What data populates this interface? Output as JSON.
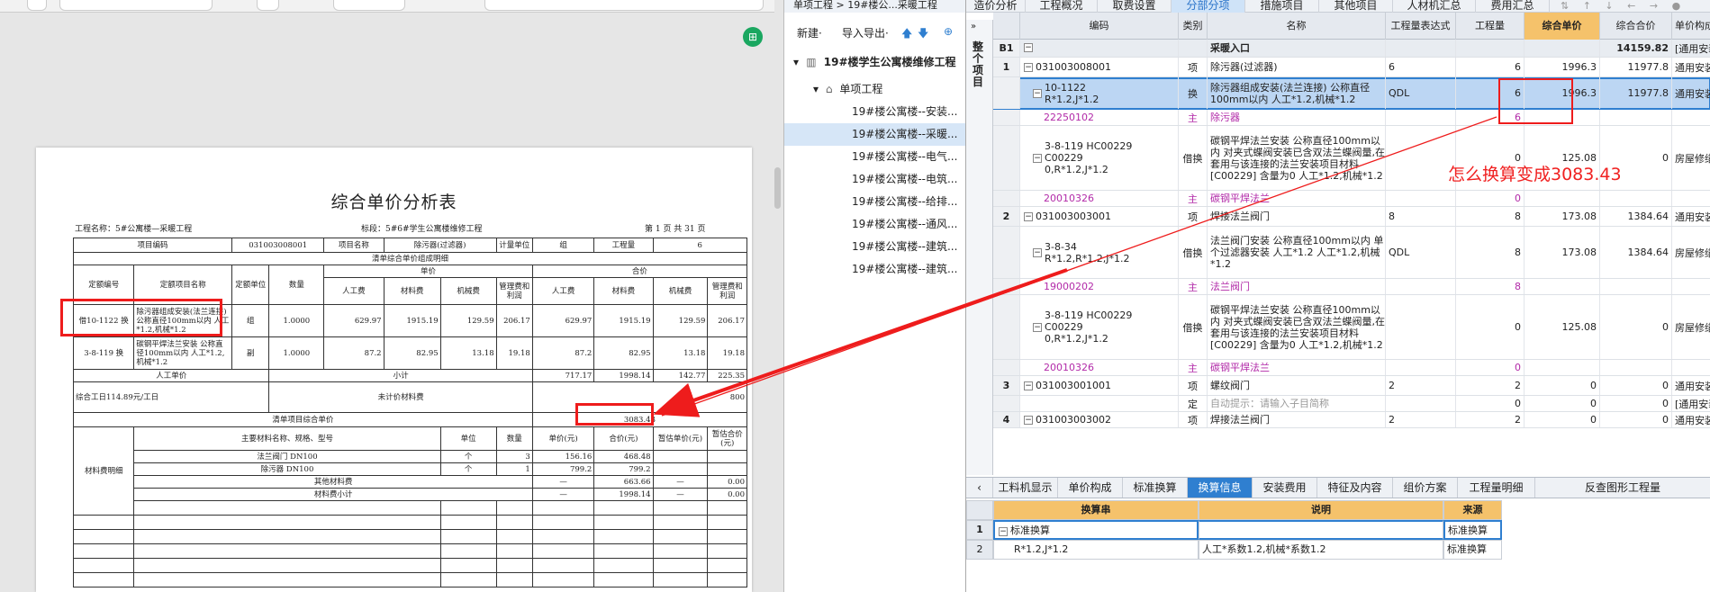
{
  "doc": {
    "title": "综合单价分析表",
    "project": "工程名称：5#公寓楼—采暖工程",
    "section": "标段：5#6#学生公寓楼维修工程",
    "page": "第 1 页    共 31 页",
    "info": [
      "项目编码",
      "031003008001",
      "项目名称",
      "除污器(过滤器)",
      "计量单位",
      "组",
      "工程量",
      "6"
    ],
    "group_title": "清单综合单价组成明细",
    "h_quota_no": "定额编号",
    "h_quota_name": "定额项目名称",
    "h_unit": "定额单位",
    "h_qty": "数量",
    "h_unit_price": "单价",
    "h_total": "合价",
    "h_cols": [
      "人工费",
      "材料费",
      "机械费",
      "管理费和利润",
      "人工费",
      "材料费",
      "机械费",
      "管理费和利润"
    ],
    "rows": [
      {
        "no": "借10-1122 换",
        "name": "除污器组成安装(法兰连接) 公称直径100mm以内 人工*1.2,机械*1.2",
        "unit": "组",
        "qty": "1.0000",
        "vals": [
          "629.97",
          "1915.19",
          "129.59",
          "206.17",
          "629.97",
          "1915.19",
          "129.59",
          "206.17"
        ]
      },
      {
        "no": "3-8-119 换",
        "name": "碳钢平焊法兰安装 公称直径100mm以内 人工*1.2,机械*1.2",
        "unit": "副",
        "qty": "1.0000",
        "vals": [
          "87.2",
          "82.95",
          "13.18",
          "19.18",
          "87.2",
          "82.95",
          "13.18",
          "19.18"
        ]
      }
    ],
    "labor_unit_price": "人工单价",
    "subtotal": "小计",
    "subtotal_vals": [
      "717.17",
      "1998.14",
      "142.77",
      "225.35"
    ],
    "workday": "综合工日114.89元/工日",
    "unpriced": "未计价材料费",
    "unpriced_val": "800",
    "unit_price_label": "清单项目综合单价",
    "unit_price_val": "3083.43",
    "mat_label": "材料费明细",
    "mat_headers": [
      "主要材料名称、规格、型号",
      "单位",
      "数量",
      "单价(元)",
      "合价(元)",
      "暂估单价(元)",
      "暂估合价(元)"
    ],
    "materials": [
      {
        "name": "法兰阀门 DN100",
        "unit": "个",
        "qty": "3",
        "price": "156.16",
        "total": "468.48",
        "est": "",
        "esttotal": ""
      },
      {
        "name": "除污器 DN100",
        "unit": "个",
        "qty": "1",
        "price": "799.2",
        "total": "799.2",
        "est": "",
        "esttotal": ""
      }
    ],
    "other_mat": "其他材料费",
    "other_vals": [
      "—",
      "663.66",
      "—",
      "0.00"
    ],
    "mat_subtotal": "材料费小计",
    "mat_sub_vals": [
      "—",
      "1998.14",
      "—",
      "0.00"
    ]
  },
  "tree": {
    "breadcrumb": "单项工程 > 19#楼公...采暖工程",
    "new": "新建·",
    "import_export": "导入导出·",
    "root": "19#楼学生公寓楼维修工程",
    "single": "单项工程",
    "items": [
      "19#楼公寓楼--安装...",
      "19#楼公寓楼--采暖...",
      "19#楼公寓楼--电气...",
      "19#楼公寓楼--电筑...",
      "19#楼公寓楼--给排...",
      "19#楼公寓楼--通风...",
      "19#楼公寓楼--建筑...",
      "19#楼公寓楼--建筑..."
    ]
  },
  "grid": {
    "tabs": [
      "造价分析",
      "工程概况",
      "取费设置",
      "分部分项",
      "措施项目",
      "其他项目",
      "人材机汇总",
      "费用汇总"
    ],
    "side_label": "整个项目",
    "headers": [
      "编码",
      "类别",
      "名称",
      "工程量表达式",
      "工程量",
      "综合单价",
      "综合合价",
      "单价构成文件"
    ],
    "rows": [
      {
        "idx": "B1",
        "code": "",
        "type": "",
        "name": "采暖入口",
        "expr": "",
        "qty": "",
        "up": "",
        "total": "14159.82",
        "file": "[通用安装..."
      },
      {
        "idx": "1",
        "code": "031003008001",
        "type": "项",
        "name": "除污器(过滤器)",
        "expr": "6",
        "qty": "6",
        "up": "1996.3",
        "total": "11977.8",
        "file": "通用安装工程"
      },
      {
        "idx": "",
        "code": "10-1122\nR*1.2,J*1.2",
        "type": "换",
        "name": "除污器组成安装(法兰连接) 公称直径100mm以内  人工*1.2,机械*1.2",
        "expr": "QDL",
        "qty": "6",
        "up": "1996.3",
        "total": "11977.8",
        "file": "通用安装工程"
      },
      {
        "idx": "",
        "code": "22250102",
        "type": "主",
        "name": "除污器",
        "expr": "",
        "qty": "6",
        "up": "",
        "total": "",
        "file": ""
      },
      {
        "idx": "",
        "code": "3-8-119 HC00229\nC00229\n0,R*1.2,J*1.2",
        "type": "借换",
        "name": "碳钢平焊法兰安装 公称直径100mm以内  对夹式蝶阀安装已含双法兰蝶阀量,在套用与该连接的法兰安装项目材料[C00229] 含量为0  人工*1.2,机械*1.2",
        "expr": "",
        "qty": "0",
        "up": "125.08",
        "total": "0",
        "file": "房屋修缮工程"
      },
      {
        "idx": "",
        "code": "20010326",
        "type": "主",
        "name": "碳钢平焊法兰",
        "expr": "",
        "qty": "0",
        "up": "",
        "total": "",
        "file": ""
      },
      {
        "idx": "2",
        "code": "031003003001",
        "type": "项",
        "name": "焊接法兰阀门",
        "expr": "8",
        "qty": "8",
        "up": "173.08",
        "total": "1384.64",
        "file": "通用安装工程"
      },
      {
        "idx": "",
        "code": "3-8-34\nR*1.2,R*1.2,J*1.2",
        "type": "借换",
        "name": "法兰阀门安装 公称直径100mm以内 单个过滤器安装 人工*1.2  人工*1.2,机械*1.2",
        "expr": "QDL",
        "qty": "8",
        "up": "173.08",
        "total": "1384.64",
        "file": "房屋修缮工程"
      },
      {
        "idx": "",
        "code": "19000202",
        "type": "主",
        "name": "法兰阀门",
        "expr": "",
        "qty": "8",
        "up": "",
        "total": "",
        "file": ""
      },
      {
        "idx": "",
        "code": "3-8-119 HC00229\nC00229\n0,R*1.2,J*1.2",
        "type": "借换",
        "name": "碳钢平焊法兰安装 公称直径100mm以内  对夹式蝶阀安装已含双法兰蝶阀量,在套用与该连接的法兰安装项目材料[C00229] 含量为0  人工*1.2,机械*1.2",
        "expr": "",
        "qty": "0",
        "up": "125.08",
        "total": "0",
        "file": "房屋修缮工程"
      },
      {
        "idx": "",
        "code": "20010326",
        "type": "主",
        "name": "碳钢平焊法兰",
        "expr": "",
        "qty": "0",
        "up": "",
        "total": "",
        "file": ""
      },
      {
        "idx": "3",
        "code": "031003001001",
        "type": "项",
        "name": "螺纹阀门",
        "expr": "2",
        "qty": "2",
        "up": "0",
        "total": "0",
        "file": "通用安装工程"
      },
      {
        "idx": "",
        "code": "",
        "type": "定",
        "name": "自动提示：请输入子目简称",
        "expr": "",
        "qty": "0",
        "up": "0",
        "total": "0",
        "file": "[通用安装工..."
      },
      {
        "idx": "4",
        "code": "031003003002",
        "type": "项",
        "name": "焊接法兰阀门",
        "expr": "2",
        "qty": "2",
        "up": "0",
        "total": "0",
        "file": "通用安装工程"
      }
    ],
    "bottom_tabs": [
      "工料机显示",
      "单价构成",
      "标准换算",
      "换算信息",
      "安装费用",
      "特征及内容",
      "组价方案",
      "工程量明细",
      "反查图形工程量"
    ],
    "sub_headers": [
      "换算串",
      "说明",
      "来源"
    ],
    "sub_rows": [
      {
        "idx": "1",
        "expr": "标准换算",
        "desc": "",
        "src": "标准换算"
      },
      {
        "idx": "2",
        "expr": "R*1.2,J*1.2",
        "desc": "人工*系数1.2,机械*系数1.2",
        "src": "标准换算"
      }
    ]
  },
  "annotation": "怎么换算变成3083.43",
  "colors": {
    "highlight": "#f5c26b",
    "selected_row": "#bcd6f3",
    "active_tab": "#2f7fd0",
    "annotation": "#f02020",
    "main_material": "#b22aa8"
  }
}
